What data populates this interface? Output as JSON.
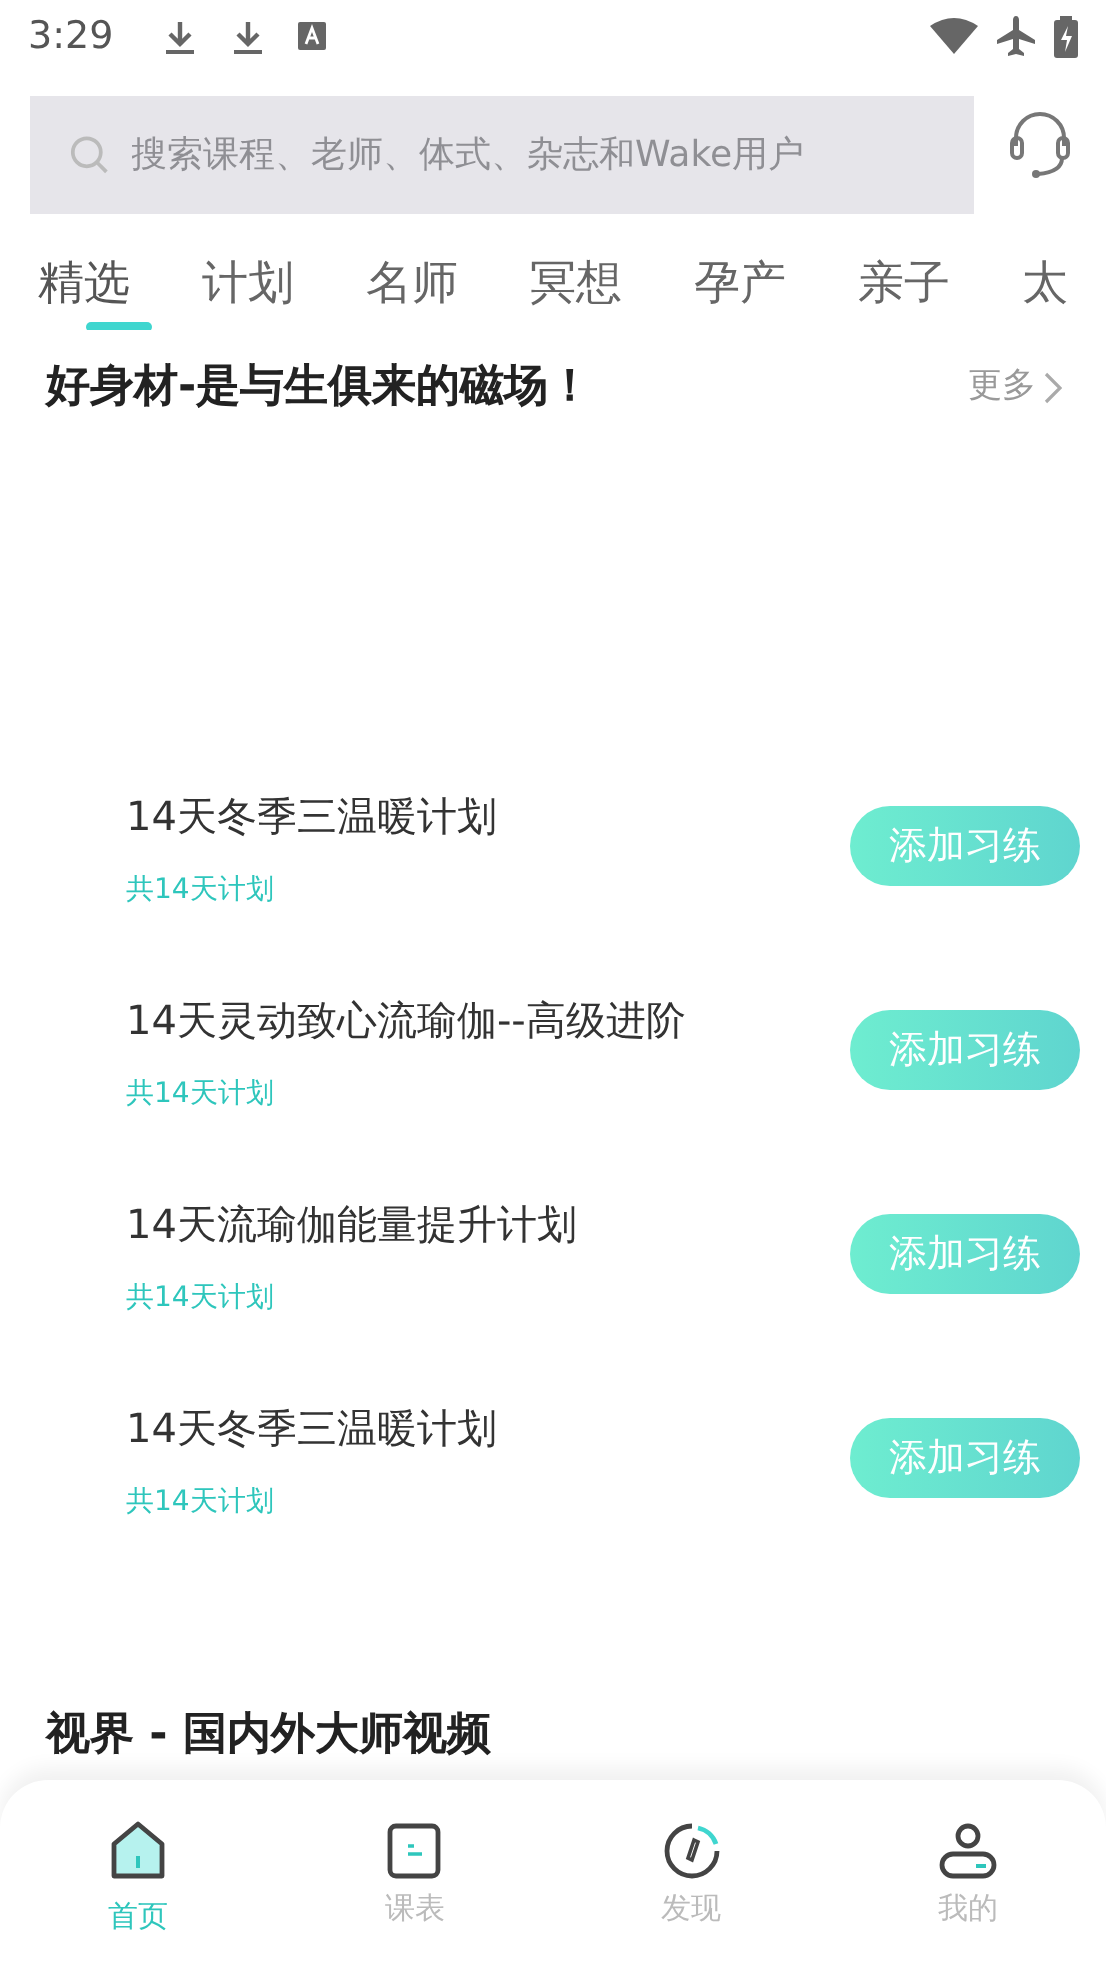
{
  "status_bar": {
    "time": "3:29"
  },
  "search": {
    "placeholder": "搜索课程、老师、体式、杂志和Wake用户"
  },
  "tabs": [
    {
      "label": "精选",
      "selected": true
    },
    {
      "label": "计划",
      "selected": false
    },
    {
      "label": "名师",
      "selected": false
    },
    {
      "label": "冥想",
      "selected": false
    },
    {
      "label": "孕产",
      "selected": false
    },
    {
      "label": "亲子",
      "selected": false
    },
    {
      "label": "太",
      "selected": false
    }
  ],
  "section": {
    "title": "好身材-是与生俱来的磁场！",
    "more": "更多"
  },
  "plans": [
    {
      "title": "14天冬季三温暖计划",
      "subtitle": "共14天计划",
      "button": "添加习练"
    },
    {
      "title": "14天灵动致心流瑜伽--高级进阶",
      "subtitle": "共14天计划",
      "button": "添加习练"
    },
    {
      "title": "14天流瑜伽能量提升计划",
      "subtitle": "共14天计划",
      "button": "添加习练"
    },
    {
      "title": "14天冬季三温暖计划",
      "subtitle": "共14天计划",
      "button": "添加习练"
    }
  ],
  "section_2": {
    "title": "视界 - 国内外大师视频"
  },
  "bottom_nav": [
    {
      "label": "首页",
      "selected": true
    },
    {
      "label": "课表",
      "selected": false
    },
    {
      "label": "发现",
      "selected": false
    },
    {
      "label": "我的",
      "selected": false
    }
  ]
}
